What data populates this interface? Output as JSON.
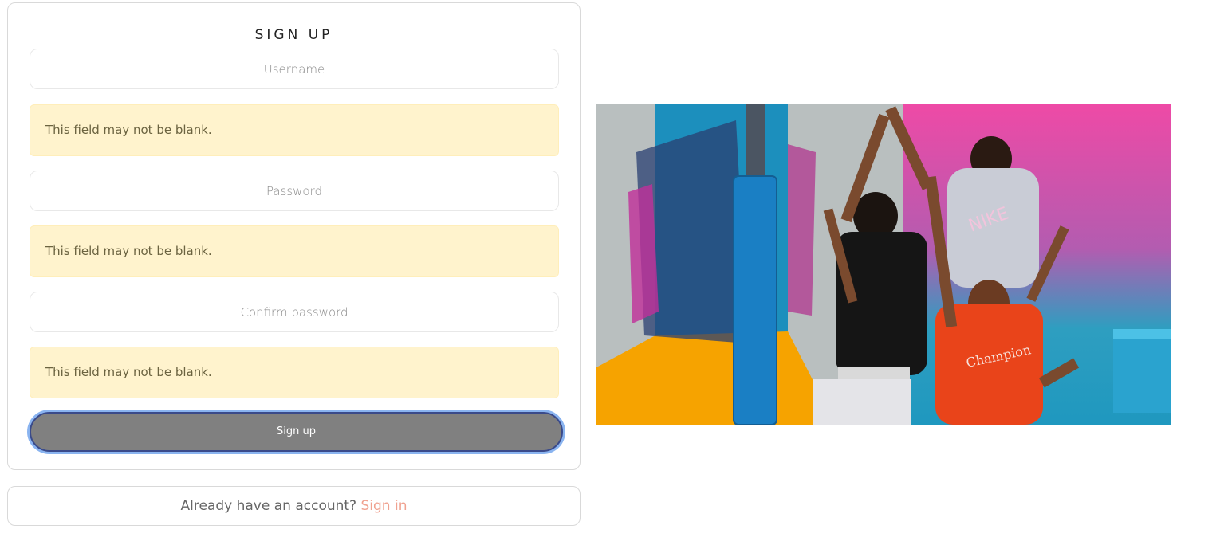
{
  "form": {
    "title": "SIGN UP",
    "username_placeholder": "Username",
    "password_placeholder": "Password",
    "confirm_placeholder": "Confirm password",
    "username_error": "This field may not be blank.",
    "password_error": "This field may not be blank.",
    "confirm_error": "This field may not be blank.",
    "submit_label": "Sign up"
  },
  "signin": {
    "prompt": "Already have an account?",
    "link": "Sign in"
  },
  "colors": {
    "alert_bg": "#fff3cd",
    "button_bg": "#808080",
    "link": "#f0a290"
  }
}
